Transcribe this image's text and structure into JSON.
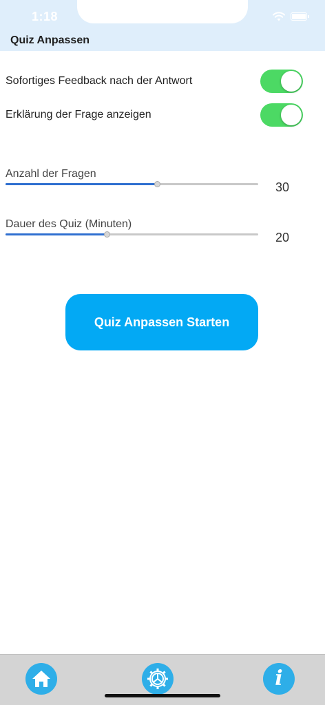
{
  "status_bar": {
    "time": "1:18",
    "icons": [
      "wifi-icon",
      "battery-icon"
    ]
  },
  "header": {
    "title": "Quiz Anpassen"
  },
  "settings": {
    "toggles": [
      {
        "label": "Sofortiges Feedback nach der Antwort",
        "on": true
      },
      {
        "label": "Erklärung der Frage anzeigen",
        "on": true
      }
    ],
    "sliders": [
      {
        "label": "Anzahl der Fragen",
        "value": "30",
        "fill_fraction": 0.6
      },
      {
        "label": "Dauer des Quiz (Minuten)",
        "value": "20",
        "fill_fraction": 0.4
      }
    ]
  },
  "start_button": {
    "label": "Quiz Anpassen Starten"
  },
  "tab_bar": {
    "items": [
      {
        "icon": "home-icon"
      },
      {
        "icon": "settings-gear-icon"
      },
      {
        "icon": "info-icon",
        "glyph": "i"
      }
    ]
  },
  "colors": {
    "header_bg": "#dfeefb",
    "toggle_on": "#4cd964",
    "slider_fill": "#2f6fd0",
    "button_bg": "#03a9f4",
    "tab_icon_bg": "#2eaee8",
    "tab_bar_bg": "#d4d4d4"
  }
}
